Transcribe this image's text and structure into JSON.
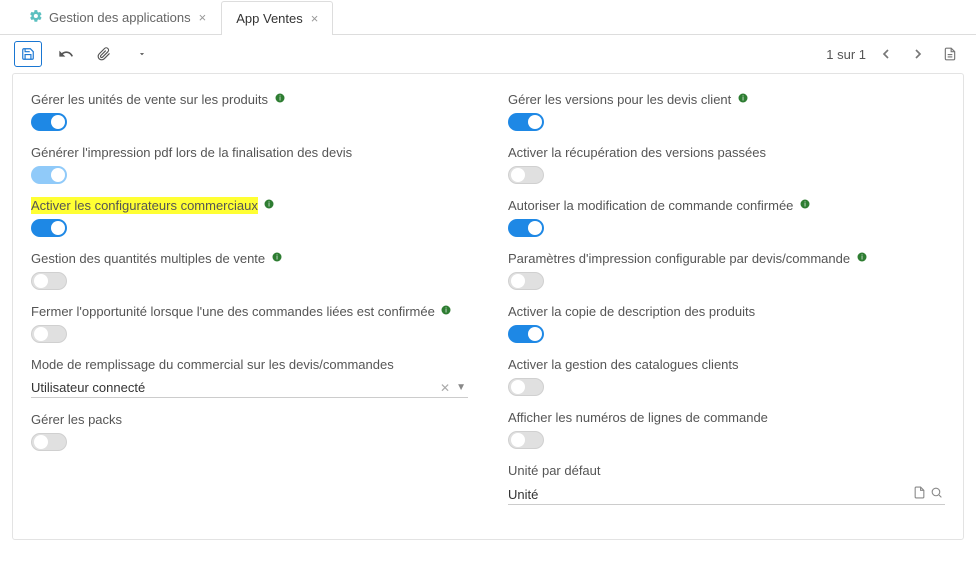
{
  "tabs": {
    "manage": "Gestion des applications",
    "sales": "App Ventes"
  },
  "toolbar": {
    "page_indicator": "1 sur 1"
  },
  "left": {
    "units": {
      "label": "Gérer les unités de vente sur les produits",
      "info": true,
      "on": true
    },
    "pdf": {
      "label": "Générer l'impression pdf lors de la finalisation des devis",
      "info": false,
      "on": true,
      "light": true
    },
    "config": {
      "label": "Activer les configurateurs commerciaux",
      "info": true,
      "on": true,
      "highlight": true
    },
    "qty": {
      "label": "Gestion des quantités multiples de vente",
      "info": true,
      "on": false
    },
    "close_opp": {
      "label": "Fermer l'opportunité lorsque l'une des commandes liées est confirmée",
      "info": true,
      "on": false
    },
    "fill_mode": {
      "label": "Mode de remplissage du commercial sur les devis/commandes",
      "value": "Utilisateur connecté"
    },
    "packs": {
      "label": "Gérer les packs",
      "info": false,
      "on": false
    }
  },
  "right": {
    "versions": {
      "label": "Gérer les versions pour les devis client",
      "info": true,
      "on": true
    },
    "recover": {
      "label": "Activer la récupération des versions passées",
      "info": false,
      "on": false
    },
    "modify": {
      "label": "Autoriser la modification de commande confirmée",
      "info": true,
      "on": true
    },
    "print_params": {
      "label": "Paramètres d'impression configurable par devis/commande",
      "info": true,
      "on": false
    },
    "copy_desc": {
      "label": "Activer la copie de description des produits",
      "info": false,
      "on": true
    },
    "catalogs": {
      "label": "Activer la gestion des catalogues clients",
      "info": false,
      "on": false
    },
    "line_numbers": {
      "label": "Afficher les numéros de lignes de commande",
      "info": false,
      "on": false
    },
    "default_unit": {
      "label": "Unité par défaut",
      "value": "Unité"
    }
  }
}
